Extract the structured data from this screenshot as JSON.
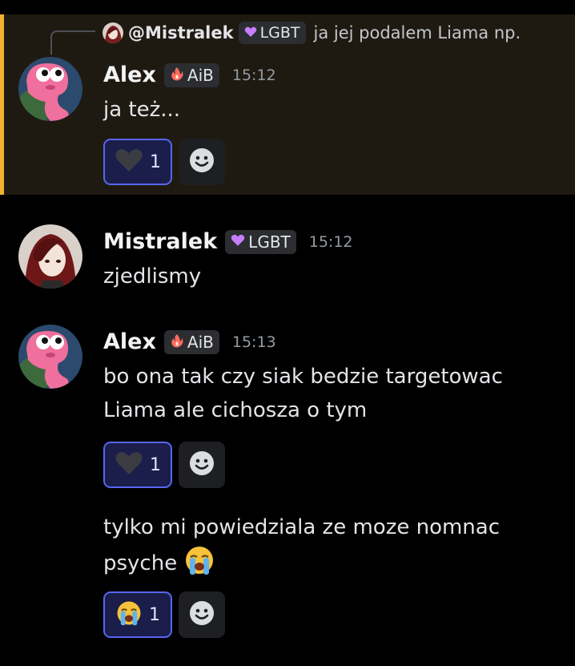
{
  "reply": {
    "username": "@Mistralek",
    "tag": "LGBT",
    "text": "ja jej podalem Liama np."
  },
  "messages": [
    {
      "username": "Alex",
      "tag": "AiB",
      "time": "15:12",
      "text": "ja też...",
      "reaction": {
        "emoji": "heart",
        "count": "1"
      }
    },
    {
      "username": "Mistralek",
      "tag": "LGBT",
      "time": "15:12",
      "text": "zjedlismy"
    },
    {
      "username": "Alex",
      "tag": "AiB",
      "time": "15:13",
      "lines": [
        "bo ona tak czy siak bedzie targetowac",
        "Liama ale cichosza o tym"
      ],
      "reaction": {
        "emoji": "heart",
        "count": "1"
      }
    },
    {
      "lines": [
        "tylko mi powiedziala ze moze nomnac",
        "psyche"
      ],
      "inline_emoji": "loudly-crying-face",
      "reaction": {
        "emoji": "loudly-crying-face",
        "count": "1"
      }
    }
  ],
  "colors": {
    "highlight_bg": "#1f1a11",
    "highlight_bar": "#f0b232",
    "reaction_border": "#5865f2"
  }
}
